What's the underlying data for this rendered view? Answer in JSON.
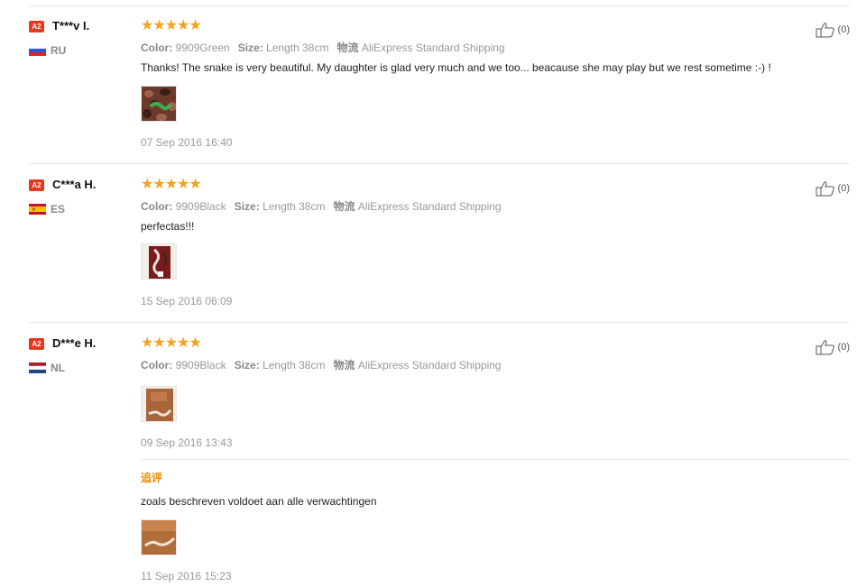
{
  "labels": {
    "color": "Color:",
    "size": "Size:",
    "shipping": "物流"
  },
  "colors": {
    "star": "#f7a21b",
    "badge": "#e4381f",
    "additional": "#f08a00"
  },
  "reviews": [
    {
      "badge": "A2",
      "name": "T***v I.",
      "country": "RU",
      "flag": "flag-russia",
      "stars": "★★★★★",
      "rating": 5,
      "color": "9909Green",
      "size": "Length 38cm",
      "shipping": "AliExpress Standard Shipping",
      "text": "Thanks! The snake is very beautiful. My daughter is glad very much and we too... beacause she may play but we rest sometime :-) !",
      "date": "07 Sep 2016 16:40",
      "likes": "(0)"
    },
    {
      "badge": "A2",
      "name": "C***a H.",
      "country": "ES",
      "flag": "flag-spain",
      "stars": "★★★★★",
      "rating": 5,
      "color": "9909Black",
      "size": "Length 38cm",
      "shipping": "AliExpress Standard Shipping",
      "text": "perfectas!!!",
      "date": "15 Sep 2016 06:09",
      "likes": "(0)"
    },
    {
      "badge": "A2",
      "name": "D***e H.",
      "country": "NL",
      "flag": "flag-netherlands",
      "stars": "★★★★★",
      "rating": 5,
      "color": "9909Black",
      "size": "Length 38cm",
      "shipping": "AliExpress Standard Shipping",
      "date": "09 Sep 2016 13:43",
      "likes": "(0)",
      "additional": {
        "label": "追评",
        "text": "zoals beschreven voldoet aan alle verwachtingen",
        "date": "11 Sep 2016 15:23"
      }
    }
  ]
}
